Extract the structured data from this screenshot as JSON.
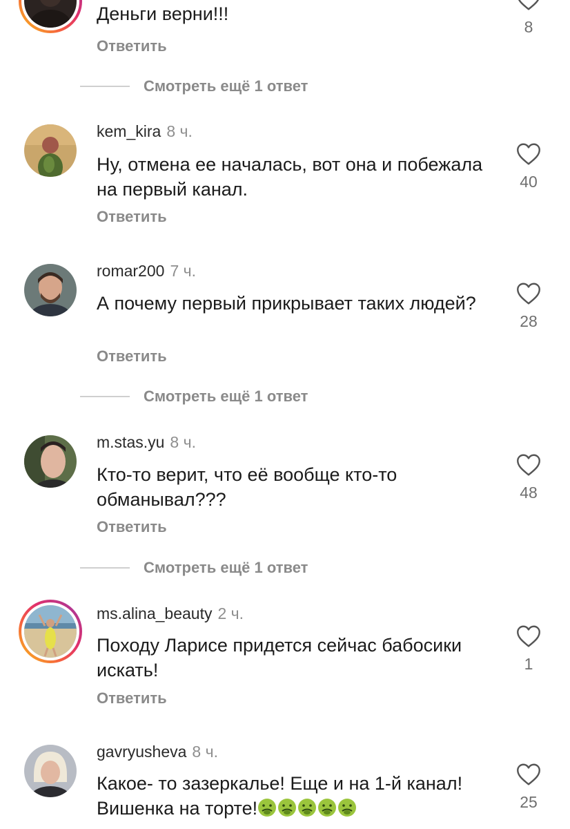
{
  "ui": {
    "heart_icon": "heart-outline-icon",
    "story_ring_colors": [
      "#f9c11a",
      "#f56040",
      "#e1306c",
      "#c13584",
      "#8a3ab9"
    ]
  },
  "comments": [
    {
      "username": "",
      "time": "",
      "text": "Деньги верни!!!",
      "reply_label": "Ответить",
      "likes": "8",
      "more_replies": "Смотреть ещё 1 ответ"
    },
    {
      "username": "kem_kira",
      "time": "8 ч.",
      "text": "Ну, отмена ее началась, вот она и побежала на первый канал.",
      "reply_label": "Ответить",
      "likes": "40"
    },
    {
      "username": "romar200",
      "time": "7 ч.",
      "text": "А почему первый прикрывает таких людей?",
      "reply_label": "Ответить",
      "likes": "28",
      "more_replies": "Смотреть ещё 1 ответ"
    },
    {
      "username": "m.stas.yu",
      "time": "8 ч.",
      "text": "Кто-то верит, что её вообще кто-то обманывал???",
      "reply_label": "Ответить",
      "likes": "48",
      "more_replies": "Смотреть ещё 1 ответ"
    },
    {
      "username": "ms.alina_beauty",
      "time": "2 ч.",
      "text": "Походу Ларисе придется сейчас бабосики искать!",
      "reply_label": "Ответить",
      "likes": "1"
    },
    {
      "username": "gavryusheva",
      "time": "8 ч.",
      "text": "Какое- то зазеркалье!  Еще и на 1-й канал! Вишенка на торте!",
      "emoji": "nauseated-face-emoji x5",
      "likes": "25"
    }
  ]
}
